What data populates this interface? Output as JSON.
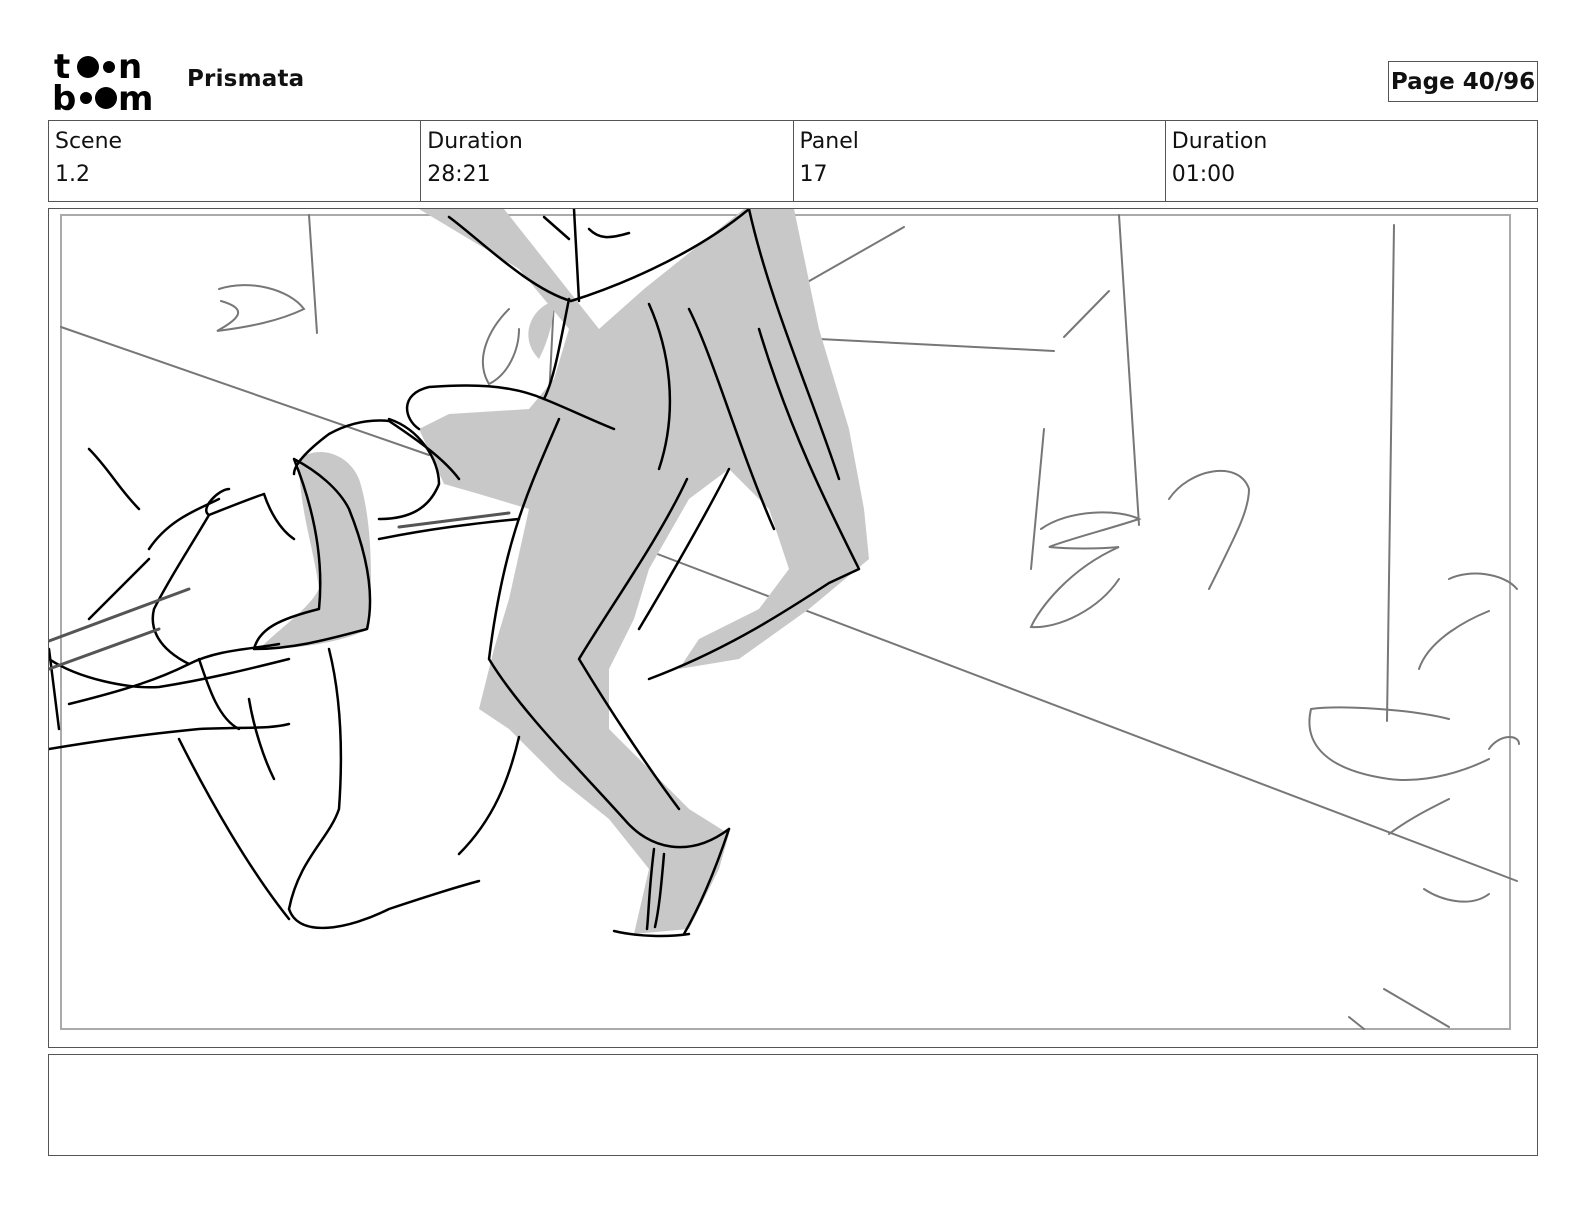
{
  "header": {
    "logo_text": "toon boom",
    "project_title": "Prismata",
    "page_label": "Page 40/96"
  },
  "info": [
    {
      "label": "Scene",
      "value": "1.2"
    },
    {
      "label": "Duration",
      "value": "28:21"
    },
    {
      "label": "Panel",
      "value": "17"
    },
    {
      "label": "Duration",
      "value": "01:00"
    }
  ],
  "panel": {
    "image": "storyboard-sketch",
    "description_colors": {
      "fill": "#c8c8c8",
      "line": "#000000",
      "background_line": "#777777"
    }
  },
  "notes": {
    "text": ""
  }
}
